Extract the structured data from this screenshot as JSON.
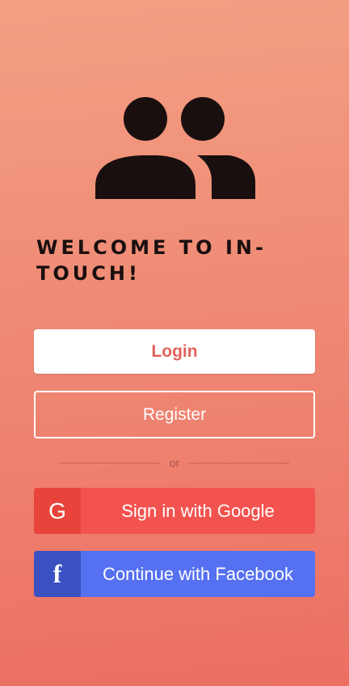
{
  "welcome": {
    "title": "WELCOME TO IN-TOUCH!"
  },
  "buttons": {
    "login_label": "Login",
    "register_label": "Register"
  },
  "divider": {
    "text": "or"
  },
  "social": {
    "google": {
      "icon_text": "G",
      "label": "Sign in with Google"
    },
    "facebook": {
      "icon_text": "f",
      "label": "Continue with Facebook"
    }
  },
  "colors": {
    "background_top": "#f3a083",
    "background_bottom": "#ec6f62",
    "login_text": "#e0625a",
    "google": "#f3534f",
    "google_badge": "#e8443b",
    "facebook": "#5570f0",
    "facebook_badge": "#3b51c2",
    "logo": "#1a0f0f"
  },
  "icons": {
    "logo": "people-group-icon"
  }
}
